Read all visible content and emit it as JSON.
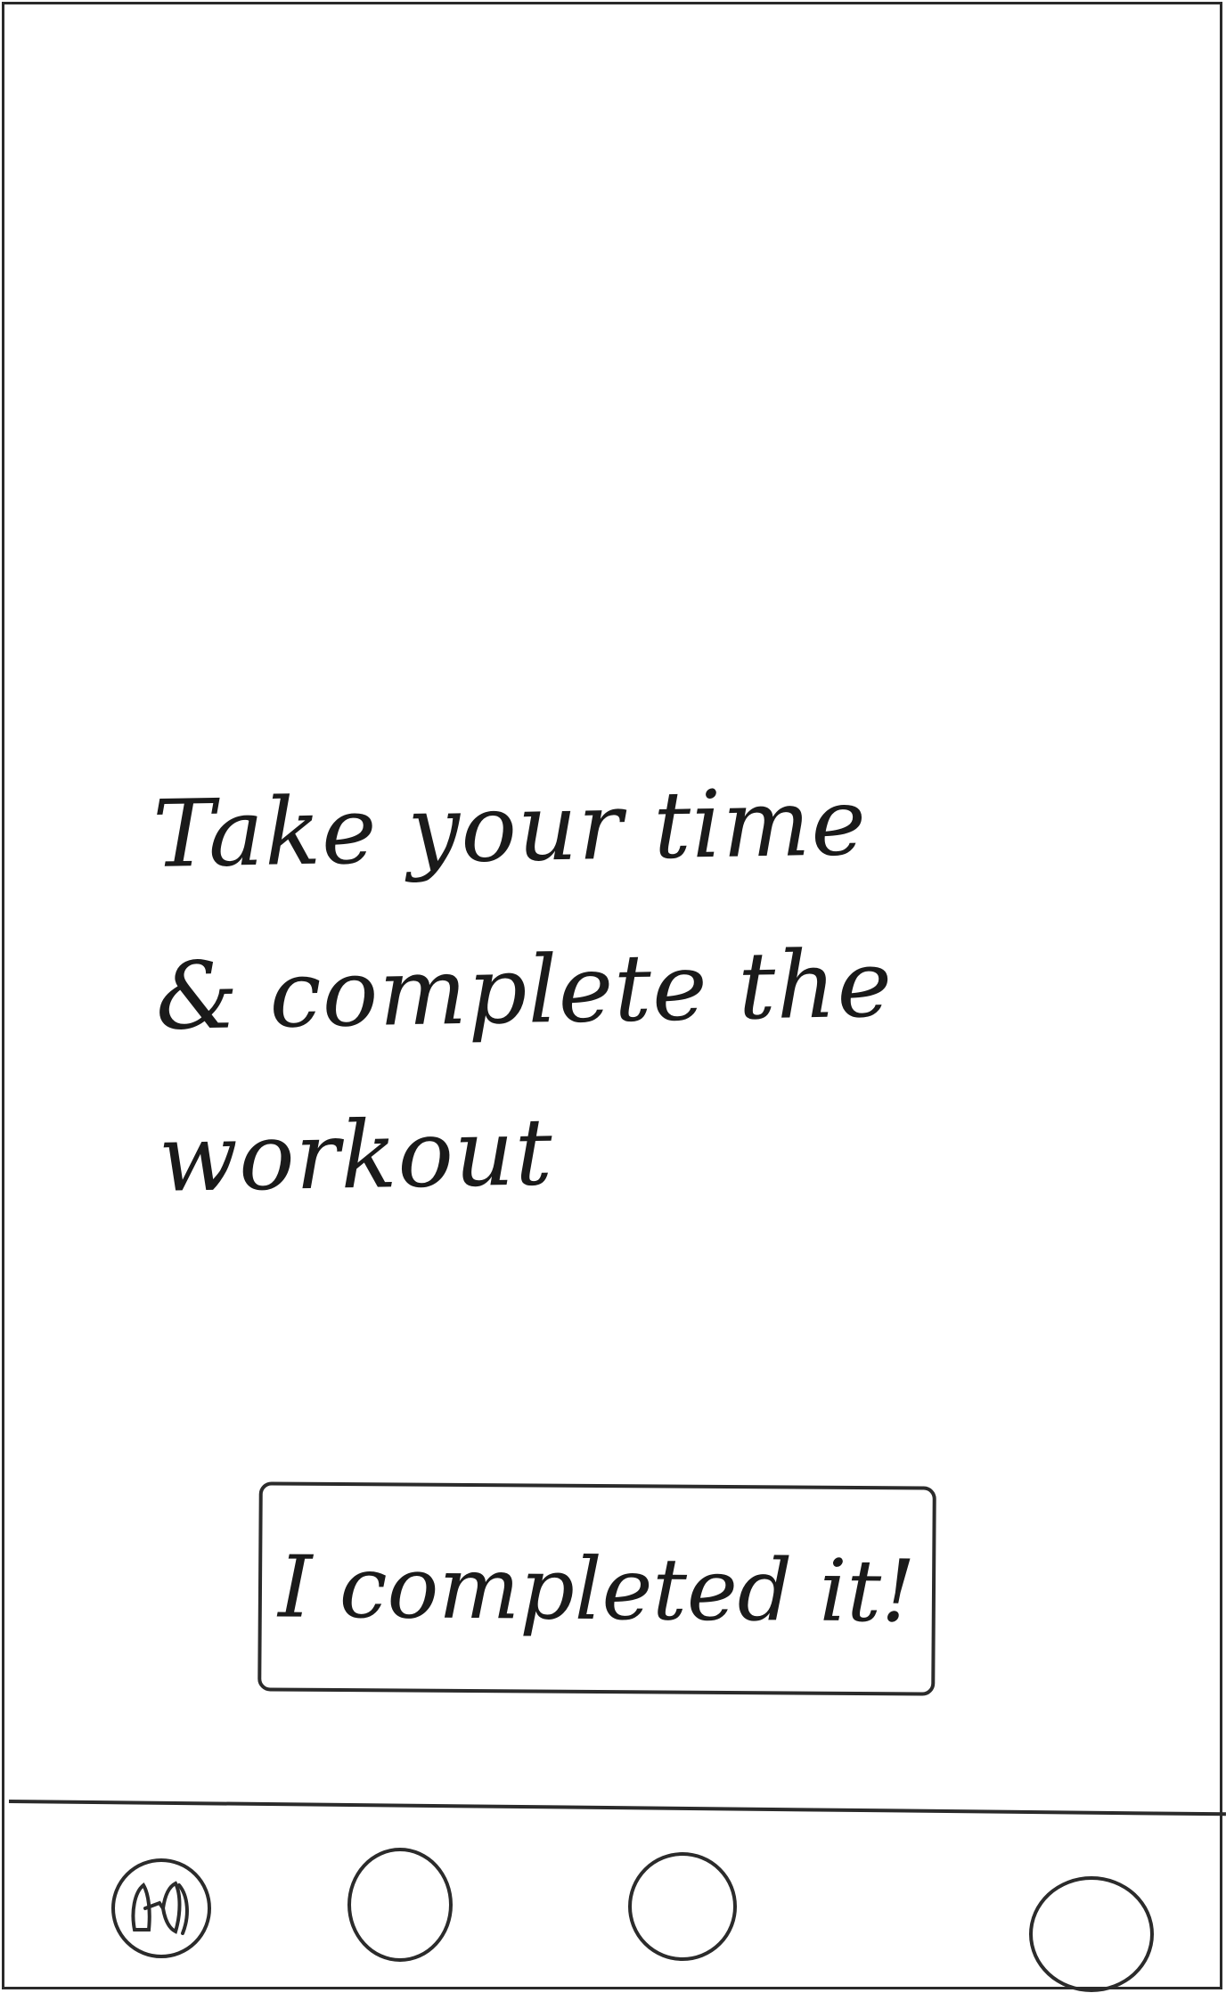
{
  "main": {
    "message_lines": [
      "Take your time",
      "& complete the",
      "workout"
    ],
    "complete_button_label": "I completed it!"
  },
  "tab_bar": {
    "tabs": [
      {
        "icon": "home-icon",
        "label": ""
      },
      {
        "icon": "circle-icon",
        "label": ""
      },
      {
        "icon": "circle-icon",
        "label": ""
      },
      {
        "icon": "circle-icon",
        "label": ""
      }
    ]
  }
}
